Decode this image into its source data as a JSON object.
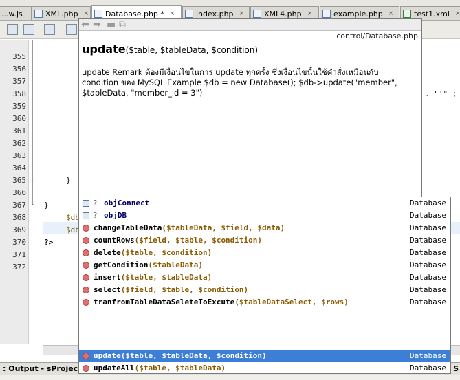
{
  "tabs": [
    {
      "label": "...w.js"
    },
    {
      "label": "XML.php",
      "close": "×"
    },
    {
      "label": "Database.php *",
      "close": "×"
    },
    {
      "label": "index.php",
      "close": "×"
    },
    {
      "label": "XML4.php",
      "close": "×"
    },
    {
      "label": "example.php",
      "close": "×"
    },
    {
      "label": "test1.xml",
      "close": "×"
    }
  ],
  "editor": {
    "line_numbers": [
      "355",
      "356",
      "357",
      "358",
      "359",
      "360",
      "361",
      "362",
      "363",
      "364",
      "365",
      "366",
      "367",
      "368",
      "369",
      "370",
      "371",
      "372"
    ],
    "lines": {
      "l358_tail": ". \"'\" ;",
      "l365": "}",
      "l367": "}",
      "l368": "$db",
      "l369": "$db->",
      "l370": "?>"
    }
  },
  "doc_popup": {
    "nav_glyphs": [
      "⬅",
      "➡",
      "▬",
      "⧉"
    ],
    "path": "control/Database.php",
    "function_name": "update",
    "function_params": "($table, $tableData, $condition)",
    "description": "update Remark ต้องมีเงื่อนไขในการ update ทุกครั้ง ซึ่งเงื่อนไขนั้นใช้คำสั่งเหมือนกับ condition ของ MySQL Example $db = new Database(); $db->update(\"member\", $tableData, \"member_id = 3\")"
  },
  "completion": {
    "items": [
      {
        "kind": "field",
        "vis": "?",
        "name": "objConnect",
        "params": "",
        "owner": "Database"
      },
      {
        "kind": "field",
        "vis": "?",
        "name": "objDB",
        "params": "",
        "owner": "Database"
      },
      {
        "kind": "method",
        "name": "changeTableData",
        "params": "($tableData, $field, $data)",
        "owner": "Database"
      },
      {
        "kind": "method",
        "name": "countRows",
        "params": "($field, $table, $condition)",
        "owner": "Database"
      },
      {
        "kind": "method",
        "name": "delete",
        "params": "($table, $condition)",
        "owner": "Database"
      },
      {
        "kind": "method",
        "name": "getCondition",
        "params": "($tableData)",
        "owner": "Database"
      },
      {
        "kind": "method",
        "name": "insert",
        "params": "($table, $tableData)",
        "owner": "Database"
      },
      {
        "kind": "method",
        "name": "select",
        "params": "($field, $table, $condition)",
        "owner": "Database"
      },
      {
        "kind": "method",
        "name": "tranfromTableDataSeleteToExcute",
        "params": "($tableDataSelect, $rows)",
        "owner": "Database"
      },
      {
        "kind": "method",
        "name": "update",
        "params": "($table, $tableData, $condition)",
        "owner": "Database",
        "selected": true
      },
      {
        "kind": "method",
        "name": "updateAll",
        "params": "($table, $tableData)",
        "owner": "Database"
      }
    ]
  },
  "output": {
    "title": ": Output - sProjects",
    "right_text": "? S"
  }
}
